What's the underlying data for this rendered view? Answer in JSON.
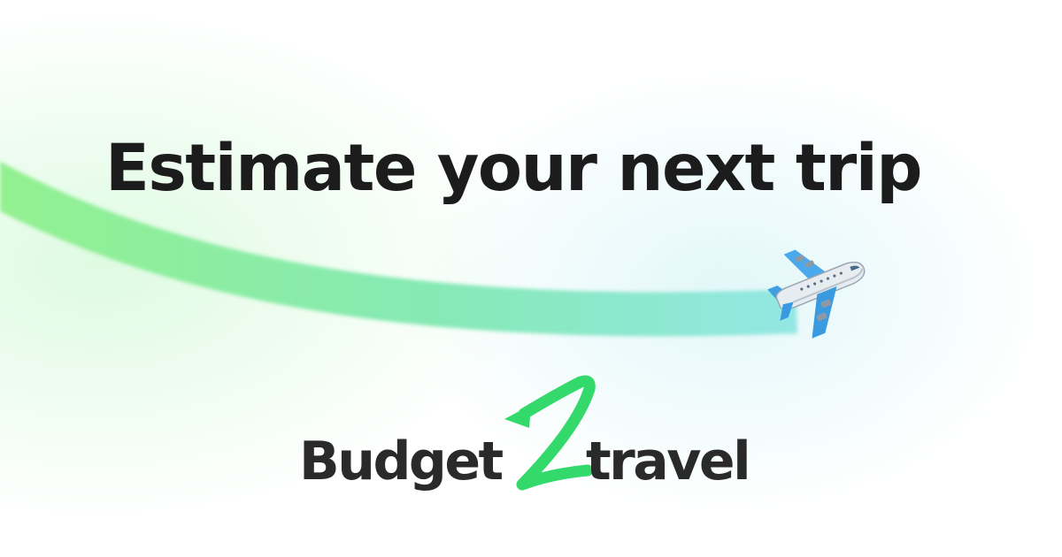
{
  "headline": "Estimate your next trip",
  "logo": {
    "word_left": "Budget",
    "word_right": "travel"
  },
  "colors": {
    "brand_green": "#33d96a",
    "trail_start": "#8ff08a",
    "trail_end": "#8ee6e2",
    "text_dark": "#1c1c1c",
    "logo_text": "#2a2a2a"
  },
  "icons": {
    "plane": "airplane-icon",
    "logo_mark": "z-arrow-icon"
  }
}
